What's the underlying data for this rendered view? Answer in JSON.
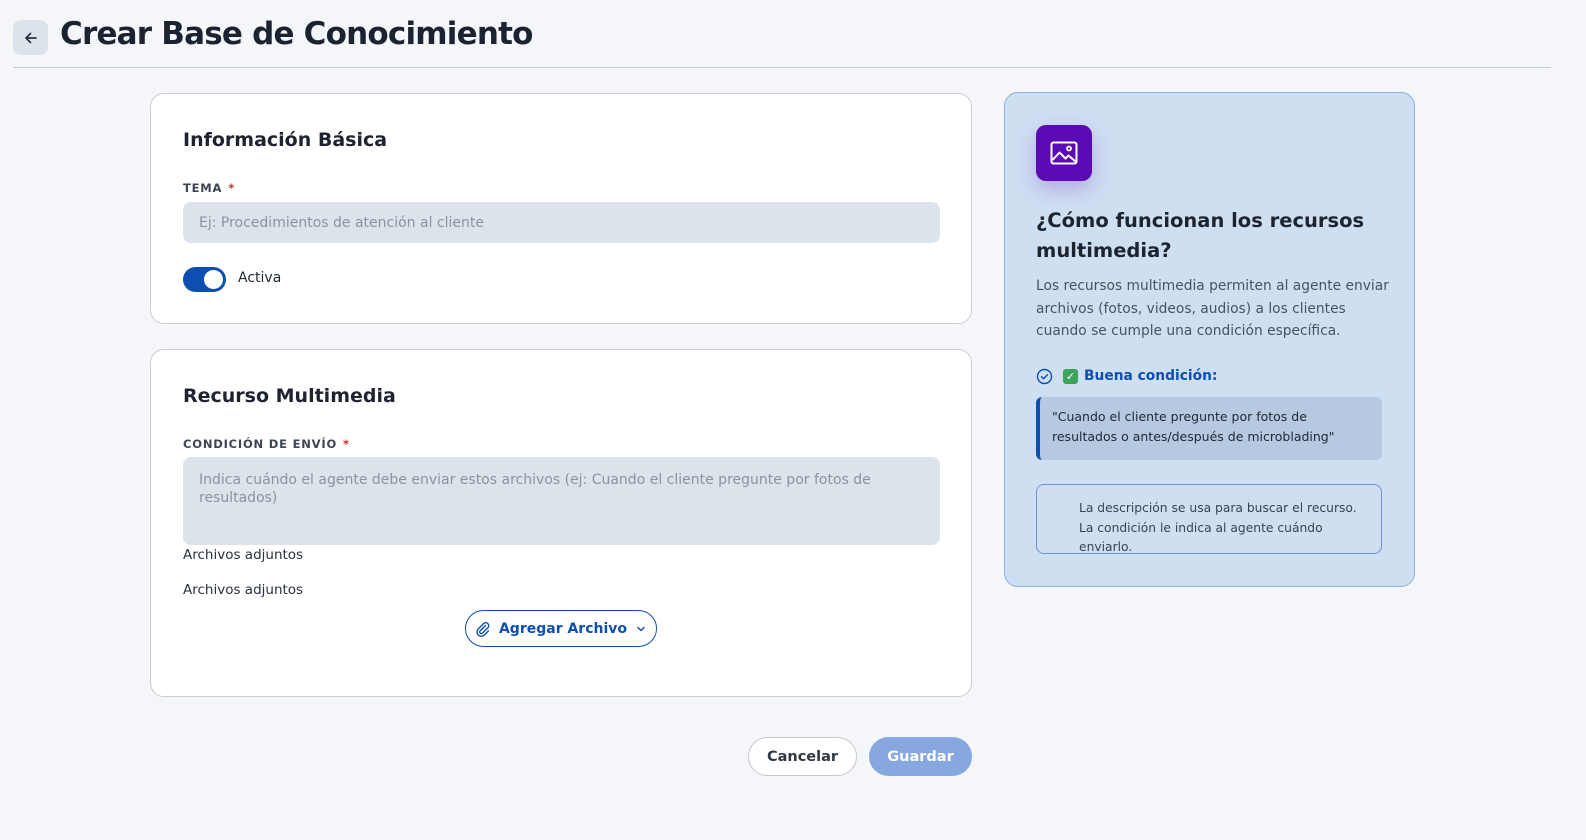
{
  "header": {
    "title": "Crear Base de Conocimiento"
  },
  "basic_info": {
    "title": "Información Básica",
    "topic_label": "TEMA",
    "required_mark": "*",
    "topic_placeholder": "Ej: Procedimientos de atención al cliente",
    "topic_value": "",
    "active_toggle": {
      "label": "Activa",
      "on": true
    }
  },
  "media": {
    "title": "Recurso Multimedia",
    "condition_label": "CONDICIÓN DE ENVÍO",
    "required_mark": "*",
    "condition_placeholder": "Indica cuándo el agente debe enviar estos archivos (ej: Cuando el cliente pregunte por fotos de resultados)",
    "condition_value": "",
    "attachments_heading": "Archivos adjuntos",
    "attachments_subheading": "Archivos adjuntos",
    "add_file_label": "Agregar Archivo"
  },
  "actions": {
    "cancel_label": "Cancelar",
    "save_label": "Guardar"
  },
  "help_panel": {
    "icon": "image-icon",
    "title": "¿Cómo funcionan los recursos multimedia?",
    "description": "Los recursos multimedia permiten al agente enviar archivos (fotos, videos, audios) a los clientes cuando se cumple una condición específica.",
    "good_condition_label": "Buena condición:",
    "example_quote": "\"Cuando el cliente pregunte por fotos de resultados o antes/después de microblading\"",
    "note": "La descripción se usa para buscar el recurso. La condición le indica al agente cuándo enviarlo."
  },
  "colors": {
    "primary": "#0d4fb0",
    "icon_bg": "#5b0bb5",
    "required": "#d22b2b",
    "save_disabled": "#86a8df",
    "panel_bg": "#cfdff2"
  }
}
